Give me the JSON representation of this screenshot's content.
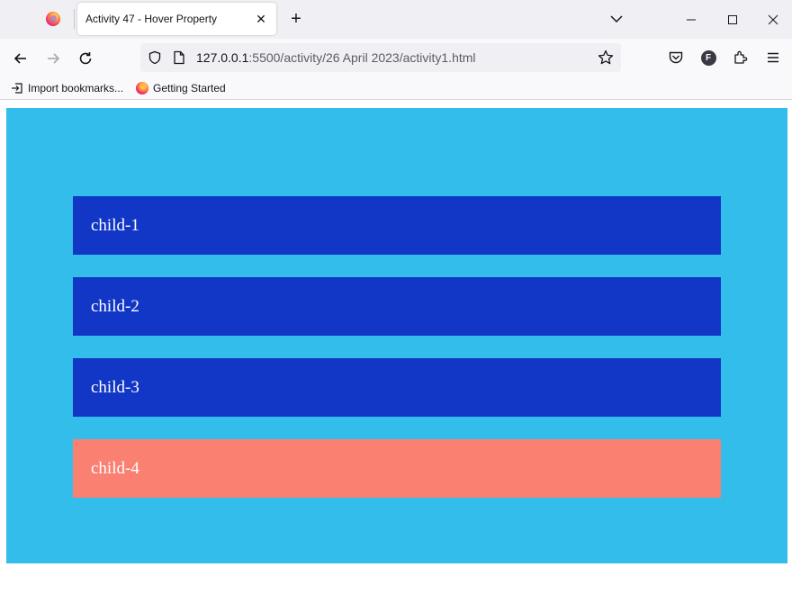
{
  "browser": {
    "tab": {
      "title": "Activity 47 - Hover Property",
      "close_glyph": "✕"
    },
    "new_tab_glyph": "+",
    "url": {
      "host": "127.0.0.1",
      "path": ":5500/activity/26 April 2023/activity1.html"
    },
    "account_initial": "F",
    "bookmarks": [
      {
        "label": "Import bookmarks..."
      },
      {
        "label": "Getting Started"
      }
    ]
  },
  "page": {
    "background_color": "#33bdeb",
    "child_color": "#1237c6",
    "hover_color": "#fa8072",
    "children": [
      {
        "label": "child-1",
        "hovered": false
      },
      {
        "label": "child-2",
        "hovered": false
      },
      {
        "label": "child-3",
        "hovered": false
      },
      {
        "label": "child-4",
        "hovered": true
      }
    ]
  }
}
